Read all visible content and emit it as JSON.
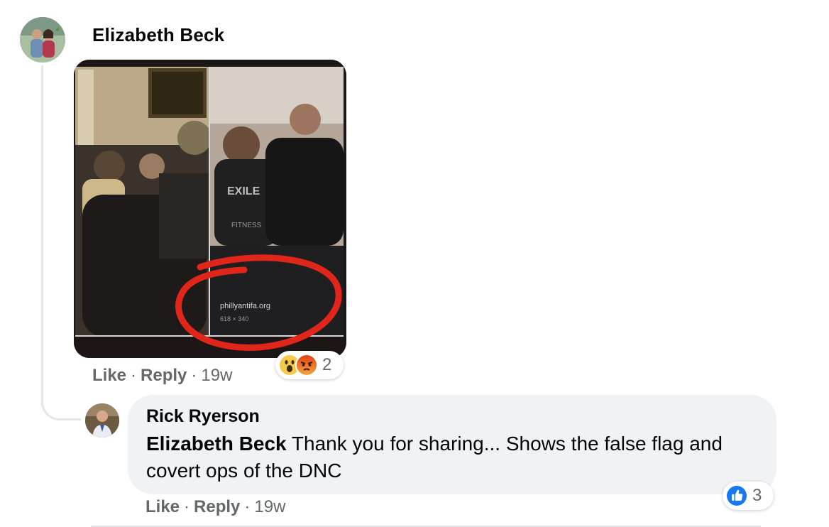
{
  "comments": [
    {
      "author": "Elizabeth Beck",
      "image": {
        "caption_site": "phillyantifa.org",
        "caption_size": "618 × 340",
        "shirt_text_1": "EXILE",
        "shirt_text_2": "FITNESS"
      },
      "actions": {
        "like": "Like",
        "reply": "Reply",
        "separator": "·",
        "time": "19w"
      },
      "reactions": {
        "icons": [
          "wow-icon",
          "angry-icon"
        ],
        "count": "2"
      }
    },
    {
      "author": "Rick Ryerson",
      "mention": "Elizabeth Beck",
      "text": " Thank you for sharing... Shows the false flag and covert ops of the DNC",
      "actions": {
        "like": "Like",
        "reply": "Reply",
        "separator": "·",
        "time": "19w"
      },
      "reactions": {
        "icons": [
          "like-icon"
        ],
        "count": "3"
      }
    }
  ],
  "colors": {
    "bubble": "#f0f2f5",
    "meta_text": "#65676b",
    "like_blue": "#1877f2",
    "angry_orange": "#f25a1c",
    "wow_yellow": "#f7c94b",
    "circle_red": "#e0261a"
  }
}
